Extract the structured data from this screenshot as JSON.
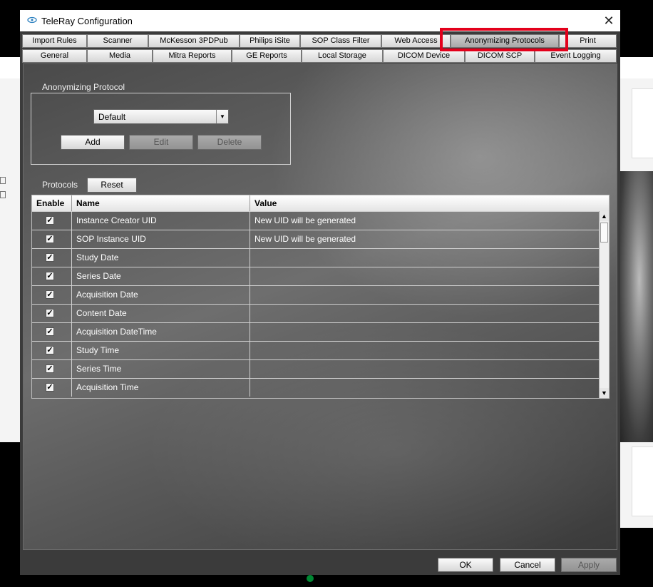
{
  "window": {
    "title": "TeleRay Configuration",
    "close_glyph": "✕"
  },
  "tabs_row1": [
    {
      "label": "Import Rules"
    },
    {
      "label": "Scanner"
    },
    {
      "label": "McKesson 3PDPub"
    },
    {
      "label": "Philips iSite"
    },
    {
      "label": "SOP Class Filter"
    },
    {
      "label": "Web Access"
    },
    {
      "label": "Anonymizing Protocols",
      "active": true
    },
    {
      "label": "Print"
    }
  ],
  "tabs_row2": [
    {
      "label": "General"
    },
    {
      "label": "Media"
    },
    {
      "label": "Mitra Reports"
    },
    {
      "label": "GE Reports"
    },
    {
      "label": "Local Storage"
    },
    {
      "label": "DICOM Device"
    },
    {
      "label": "DICOM SCP"
    },
    {
      "label": "Event Logging"
    }
  ],
  "anonymizing_protocol": {
    "group_label": "Anonymizing Protocol",
    "selected": "Default",
    "add_label": "Add",
    "edit_label": "Edit",
    "delete_label": "Delete"
  },
  "protocols": {
    "label": "Protocols",
    "reset_label": "Reset",
    "columns": [
      "Enable",
      "Name",
      "Value"
    ],
    "rows": [
      {
        "enabled": true,
        "name": "Instance Creator UID",
        "value": "New UID will be generated"
      },
      {
        "enabled": true,
        "name": "SOP Instance UID",
        "value": "New UID will be generated"
      },
      {
        "enabled": true,
        "name": "Study Date",
        "value": ""
      },
      {
        "enabled": true,
        "name": "Series Date",
        "value": ""
      },
      {
        "enabled": true,
        "name": "Acquisition Date",
        "value": ""
      },
      {
        "enabled": true,
        "name": "Content Date",
        "value": ""
      },
      {
        "enabled": true,
        "name": "Acquisition DateTime",
        "value": ""
      },
      {
        "enabled": true,
        "name": "Study Time",
        "value": ""
      },
      {
        "enabled": true,
        "name": "Series Time",
        "value": ""
      },
      {
        "enabled": true,
        "name": "Acquisition Time",
        "value": ""
      }
    ]
  },
  "footer": {
    "ok_label": "OK",
    "cancel_label": "Cancel",
    "apply_label": "Apply"
  },
  "colors": {
    "highlight": "#e3001b",
    "dialog_bg": "#3b3b3b"
  }
}
